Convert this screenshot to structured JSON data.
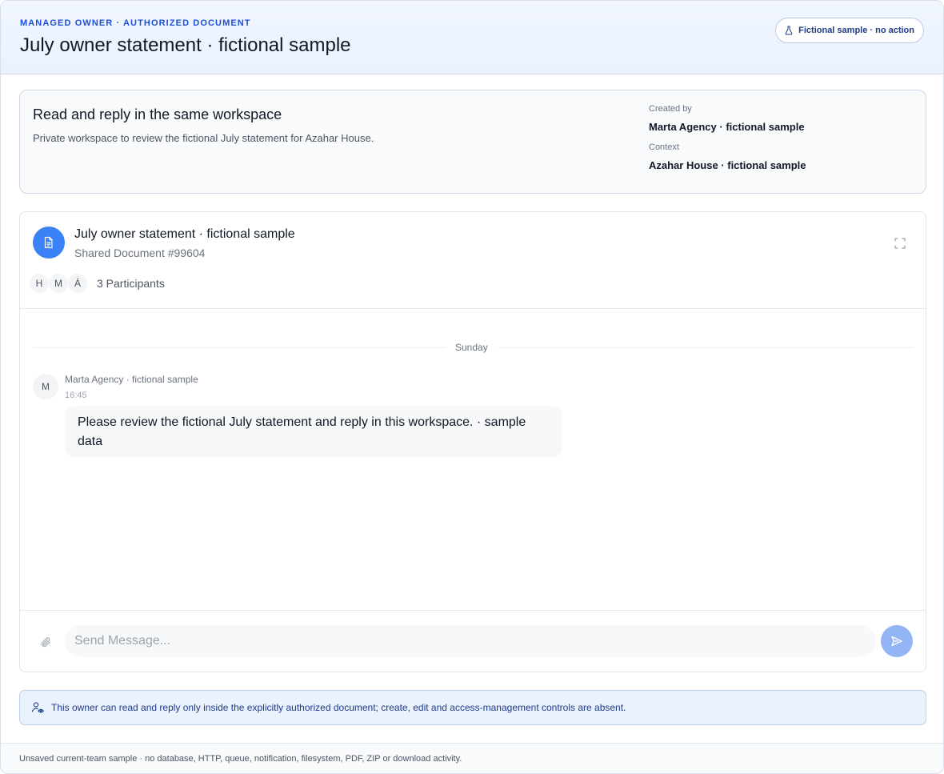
{
  "header": {
    "eyebrow": "MANAGED OWNER · AUTHORIZED DOCUMENT",
    "title": "July owner statement · fictional sample",
    "badge": "Fictional sample · no action"
  },
  "summary": {
    "title": "Read and reply in the same workspace",
    "description": "Private workspace to review the fictional July statement for Azahar House.",
    "created_by_label": "Created by",
    "created_by_value": "Marta Agency · fictional sample",
    "context_label": "Context",
    "context_value": "Azahar House · fictional sample"
  },
  "chat": {
    "title": "July owner statement · fictional sample",
    "subtitle": "Shared Document #99604",
    "participants": [
      "H",
      "M",
      "Á"
    ],
    "participants_count": "3 Participants",
    "day_separator": "Sunday",
    "messages": [
      {
        "avatar": "M",
        "author": "Marta Agency · fictional sample",
        "time": "16:45",
        "text": "Please review the fictional July statement and reply in this workspace. · sample data"
      }
    ],
    "composer_placeholder": "Send Message..."
  },
  "notice": {
    "text": "This owner can read and reply only inside the explicitly authorized document; create, edit and access-management controls are absent."
  },
  "footer": {
    "text": "Unsaved current-team sample · no database, HTTP, queue, notification, filesystem, PDF, ZIP or download activity."
  },
  "icons": {
    "badge": "flask-icon",
    "doc": "document-icon",
    "expand": "expand-icon",
    "attach": "paperclip-icon",
    "send": "send-icon",
    "notice": "user-eye-icon"
  },
  "colors": {
    "accent": "#3b82f6",
    "brand_text": "#1d4ed8",
    "send_disabled": "#93b5f5",
    "notice_bg": "#eaf3fd"
  }
}
